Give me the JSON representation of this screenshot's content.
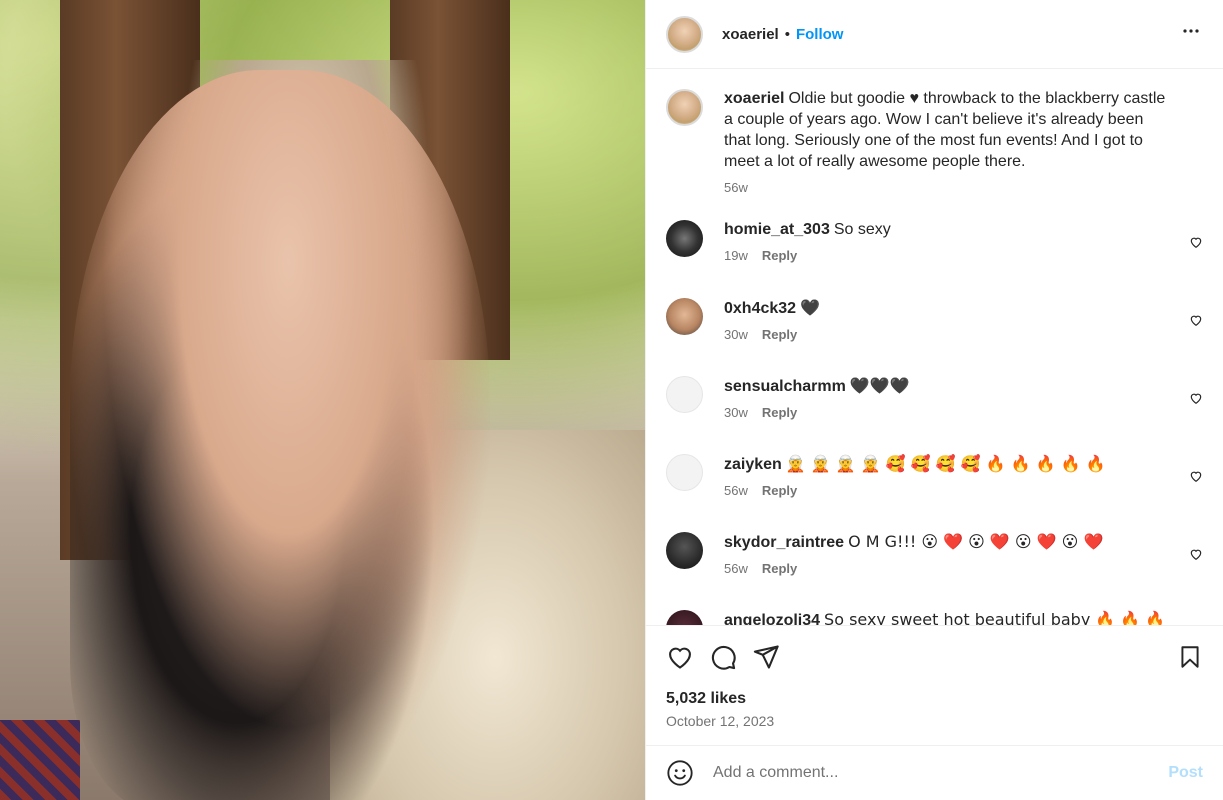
{
  "header": {
    "username": "xoaeriel",
    "separator": "•",
    "follow_label": "Follow",
    "more_label": "•••"
  },
  "caption": {
    "username": "xoaeriel",
    "text": "Oldie but goodie ♥ throwback to the blackberry castle a couple of years ago. Wow I can't believe it's already been that long. Seriously one of the most fun events! And I got to meet a lot of really awesome people there.",
    "time": "56w"
  },
  "comments": [
    {
      "username": "homie_at_303",
      "text": "So sexy",
      "time": "19w",
      "reply": "Reply"
    },
    {
      "username": "0xh4ck32",
      "text": "🖤",
      "time": "30w",
      "reply": "Reply"
    },
    {
      "username": "sensualcharmm",
      "text": "🖤🖤🖤",
      "time": "30w",
      "reply": "Reply"
    },
    {
      "username": "zaiyken",
      "text": "🧝 🧝 🧝 🧝 🥰 🥰 🥰 🥰 🔥 🔥 🔥 🔥 🔥",
      "time": "56w",
      "reply": "Reply"
    },
    {
      "username": "skydor_raintree",
      "text": "O M G!!! 😮 ❤️ 😮 ❤️ 😮 ❤️ 😮 ❤️",
      "time": "56w",
      "reply": "Reply"
    },
    {
      "username": "angelozoli34",
      "text": "So sexy sweet hot beautiful baby 🔥 🔥 🔥 ❤️ ❤️",
      "time": "",
      "reply": ""
    }
  ],
  "stats": {
    "likes": "5,032 likes",
    "date": "October 12, 2023"
  },
  "add_comment": {
    "placeholder": "Add a comment...",
    "post_label": "Post"
  },
  "colors": {
    "accent": "#0095f6",
    "post_disabled": "#b2dffc",
    "muted": "#737373"
  }
}
